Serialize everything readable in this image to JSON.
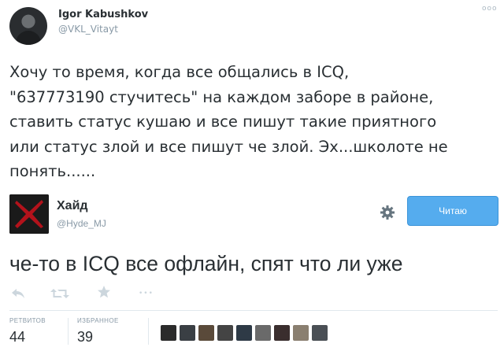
{
  "tweet": {
    "author_name": "Igor Kabushkov",
    "author_handle": "@VKL_Vitayt",
    "more_label": "ooo",
    "text": "Хочу то время, когда все общались в ICQ,\n\"637773190 стучитесь\" на каждом заборе в районе,\nставить статус кушаю и все пишут такие приятного\nили статус злой и все пишут че злой. Эх...школоте не\nпонять......"
  },
  "quoted": {
    "author_name": "Хайд",
    "author_handle": "@Hyde_MJ",
    "follow_label": "Читаю",
    "text": "че-то в ICQ все офлайн, спят что ли уже",
    "actions": {
      "more_label": "•••"
    },
    "stats": {
      "retweets_label": "РЕТВИТОВ",
      "retweets_value": "44",
      "favorites_label": "ИЗБРАННОЕ",
      "favorites_value": "39"
    },
    "liker_avatars": [
      "#2b2b2b",
      "#3a3f44",
      "#5a4a3a",
      "#444444",
      "#2e3a46",
      "#6a6a6a",
      "#3a2e2e",
      "#8a7f70",
      "#4a4f55"
    ]
  },
  "colors": {
    "follow_blue": "#55acee",
    "text": "#292f33",
    "muted": "#8899a6"
  }
}
